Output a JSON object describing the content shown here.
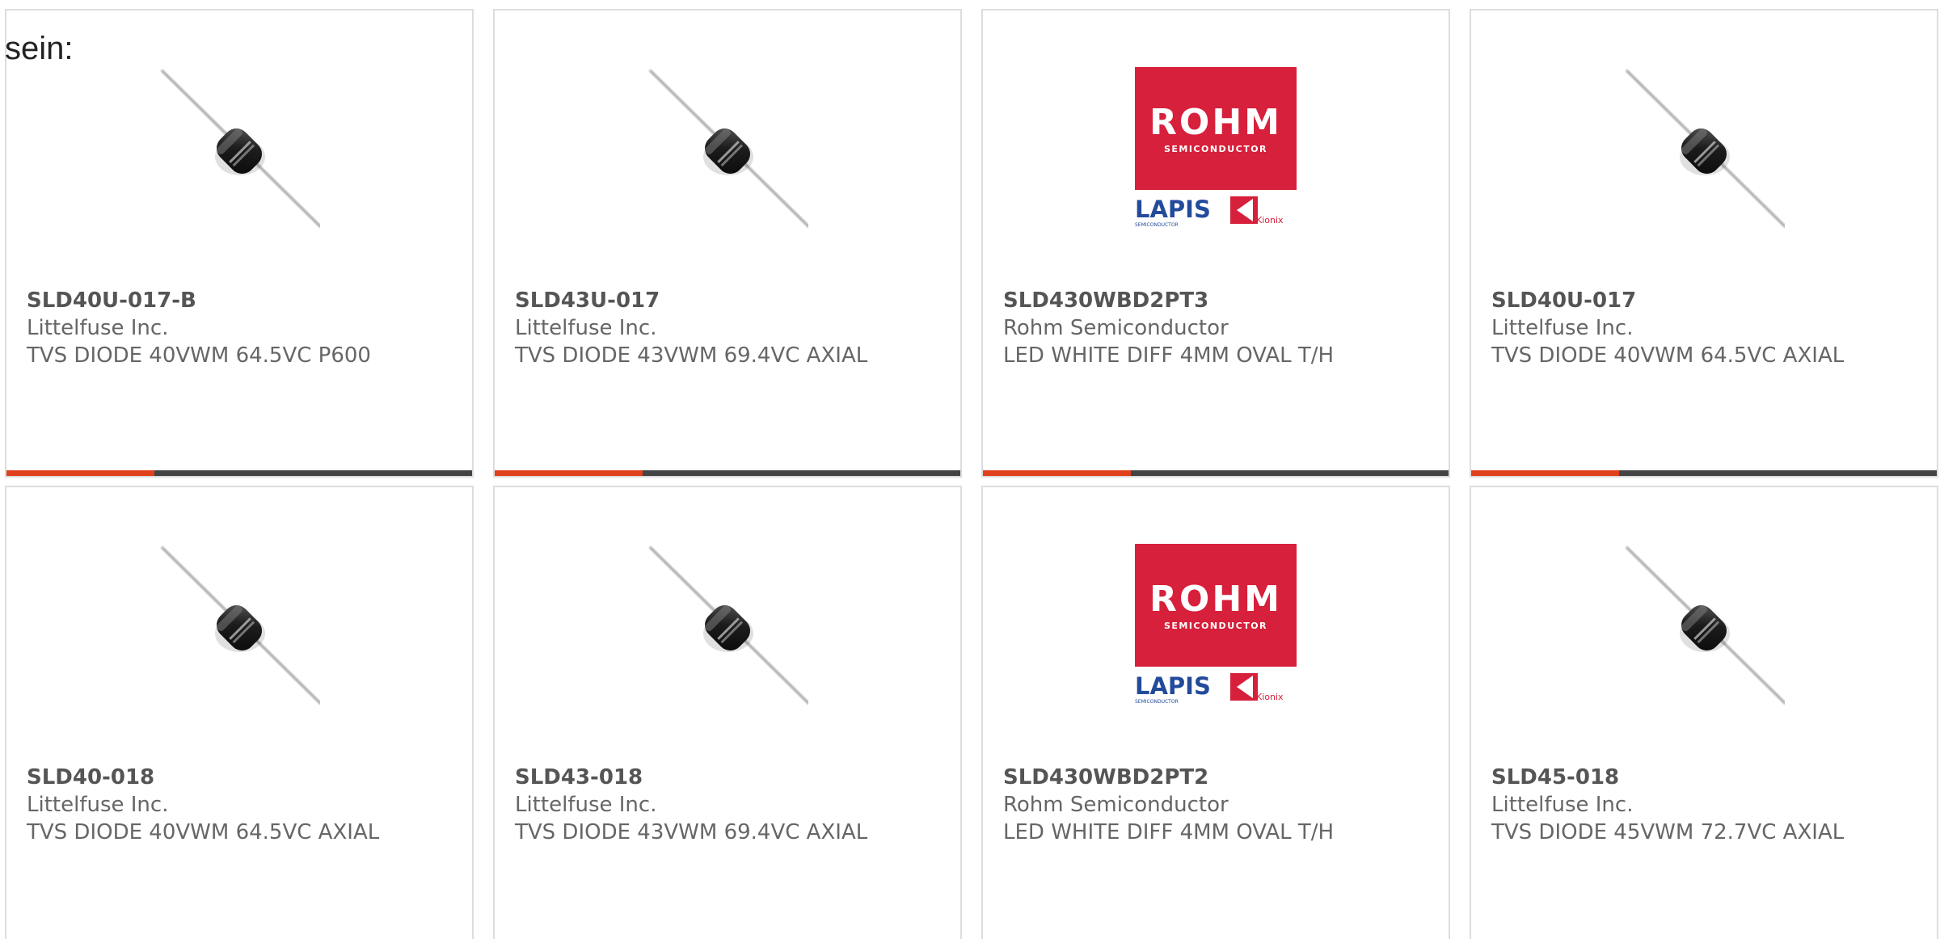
{
  "lead_text": "sein:",
  "colors": {
    "accent": "#e0401c",
    "bar": "#444444",
    "rohm_red": "#d7203b",
    "lapis_blue": "#234b9b"
  },
  "cards": [
    {
      "part_number": "SLD40U-017-B",
      "manufacturer": "Littelfuse Inc.",
      "description": "TVS DIODE 40VWM 64.5VC P600",
      "image": "axial-diode-photo",
      "show_bar": true
    },
    {
      "part_number": "SLD43U-017",
      "manufacturer": "Littelfuse Inc.",
      "description": "TVS DIODE 43VWM 69.4VC AXIAL",
      "image": "axial-diode-photo",
      "show_bar": true
    },
    {
      "part_number": "SLD430WBD2PT3",
      "manufacturer": "Rohm Semiconductor",
      "description": "LED WHITE DIFF 4MM OVAL T/H",
      "image": "rohm-logo",
      "show_bar": true
    },
    {
      "part_number": "SLD40U-017",
      "manufacturer": "Littelfuse Inc.",
      "description": "TVS DIODE 40VWM 64.5VC AXIAL",
      "image": "axial-diode-photo",
      "show_bar": true
    },
    {
      "part_number": "SLD40-018",
      "manufacturer": "Littelfuse Inc.",
      "description": "TVS DIODE 40VWM 64.5VC AXIAL",
      "image": "axial-diode-photo",
      "show_bar": false
    },
    {
      "part_number": "SLD43-018",
      "manufacturer": "Littelfuse Inc.",
      "description": "TVS DIODE 43VWM 69.4VC AXIAL",
      "image": "axial-diode-photo",
      "show_bar": false
    },
    {
      "part_number": "SLD430WBD2PT2",
      "manufacturer": "Rohm Semiconductor",
      "description": "LED WHITE DIFF 4MM OVAL T/H",
      "image": "rohm-logo",
      "show_bar": false
    },
    {
      "part_number": "SLD45-018",
      "manufacturer": "Littelfuse Inc.",
      "description": "TVS DIODE 45VWM 72.7VC AXIAL",
      "image": "axial-diode-photo",
      "show_bar": false
    }
  ],
  "rohm_logo": {
    "brand": "ROHM",
    "sub": "SEMICONDUCTOR",
    "lapis": "LAPIS",
    "lapis_sub": "SEMICONDUCTOR",
    "kionix": "Kionix"
  }
}
